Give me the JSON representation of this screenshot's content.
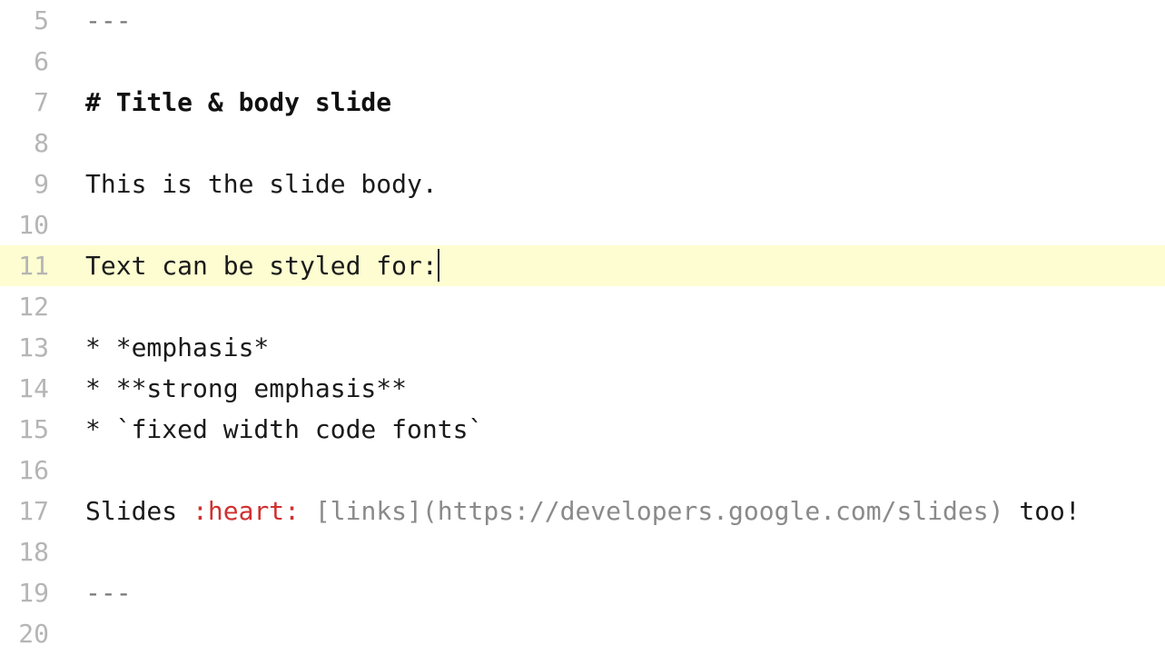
{
  "editor": {
    "active_line_index": 6,
    "cursor_after_index": 6,
    "lines": [
      {
        "num": "5",
        "segments": [
          {
            "cls": "hr",
            "text": "---"
          }
        ]
      },
      {
        "num": "6",
        "segments": [
          {
            "cls": "",
            "text": ""
          }
        ]
      },
      {
        "num": "7",
        "segments": [
          {
            "cls": "head",
            "text": "# Title & body slide"
          }
        ]
      },
      {
        "num": "8",
        "segments": [
          {
            "cls": "",
            "text": ""
          }
        ]
      },
      {
        "num": "9",
        "segments": [
          {
            "cls": "",
            "text": "This is the slide body."
          }
        ]
      },
      {
        "num": "10",
        "segments": [
          {
            "cls": "",
            "text": ""
          }
        ]
      },
      {
        "num": "11",
        "segments": [
          {
            "cls": "",
            "text": "Text can be styled for:"
          }
        ]
      },
      {
        "num": "12",
        "segments": [
          {
            "cls": "",
            "text": ""
          }
        ]
      },
      {
        "num": "13",
        "segments": [
          {
            "cls": "",
            "text": "* *emphasis*"
          }
        ]
      },
      {
        "num": "14",
        "segments": [
          {
            "cls": "",
            "text": "* **strong emphasis**"
          }
        ]
      },
      {
        "num": "15",
        "segments": [
          {
            "cls": "",
            "text": "* `fixed width code fonts`"
          }
        ]
      },
      {
        "num": "16",
        "segments": [
          {
            "cls": "",
            "text": ""
          }
        ]
      },
      {
        "num": "17",
        "segments": [
          {
            "cls": "",
            "text": "Slides "
          },
          {
            "cls": "emoji",
            "text": ":heart:"
          },
          {
            "cls": "",
            "text": " "
          },
          {
            "cls": "link",
            "text": "[links](https://developers.google.com/slides)"
          },
          {
            "cls": "",
            "text": " too!"
          }
        ]
      },
      {
        "num": "18",
        "segments": [
          {
            "cls": "",
            "text": ""
          }
        ]
      },
      {
        "num": "19",
        "segments": [
          {
            "cls": "hr",
            "text": "---"
          }
        ]
      },
      {
        "num": "20",
        "segments": [
          {
            "cls": "",
            "text": ""
          }
        ]
      }
    ]
  }
}
